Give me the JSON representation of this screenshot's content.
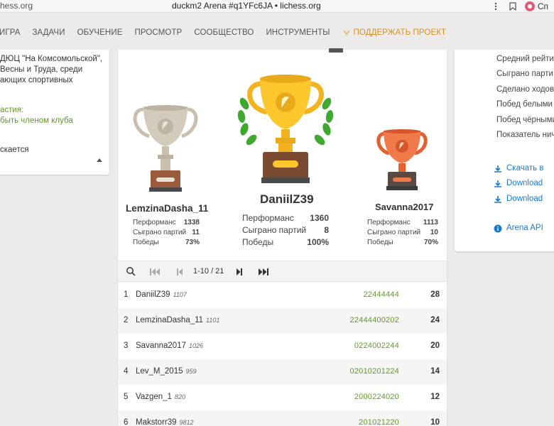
{
  "browser": {
    "url_left": "hess.org",
    "title": "duckm2 Arena #q1YFc6JA • lichess.org",
    "profile_label": "Сп"
  },
  "nav": {
    "items": [
      "ИГРА",
      "ЗАДАЧИ",
      "ОБУЧЕНИЕ",
      "ПРОСМОТР",
      "СООБЩЕСТВО",
      "ИНСТРУМЕНТЫ"
    ],
    "support": "ПОДДЕРЖАТЬ ПРОЕКТ"
  },
  "left_panel": {
    "description": "ДЮЦ \"На Комсомольской\", Весны и Труда, среди ающих спортивных",
    "condition_label": "астия:",
    "condition_link": "быть членом клуба",
    "starts": "скается"
  },
  "right_panel": {
    "stats": [
      "Средний рейти",
      "Сыграно парти",
      "Сделано ходов",
      "Побед белыми",
      "Побед чёрными",
      "Показатель нич"
    ],
    "downloads": [
      "Скачать в",
      "Download",
      "Download"
    ],
    "api": "Arena API"
  },
  "podium": {
    "first": {
      "name": "DaniilZ39",
      "performance_label": "Перформанс",
      "performance": "1360",
      "games_label": "Сыграно партий",
      "games": "8",
      "wins_label": "Победы",
      "wins": "100%"
    },
    "second": {
      "name": "LemzinaDasha_11",
      "performance_label": "Перформанс",
      "performance": "1338",
      "games_label": "Сыграно партий",
      "games": "11",
      "wins_label": "Победы",
      "wins": "73%"
    },
    "third": {
      "name": "Savanna2017",
      "performance_label": "Перформанс",
      "performance": "1113",
      "games_label": "Сыграно партий",
      "games": "10",
      "wins_label": "Победы",
      "wins": "70%"
    }
  },
  "pager": {
    "count": "1-10 / 21"
  },
  "standings": [
    {
      "rank": "1",
      "name": "DaniilZ39",
      "rating": "1107",
      "sheet": "22444444",
      "total": "28"
    },
    {
      "rank": "2",
      "name": "LemzinaDasha_11",
      "rating": "1101",
      "sheet": "22444400202",
      "total": "24"
    },
    {
      "rank": "3",
      "name": "Savanna2017",
      "rating": "1026",
      "sheet": "0224002244",
      "total": "20"
    },
    {
      "rank": "4",
      "name": "Lev_M_2015",
      "rating": "959",
      "sheet": "02010201224",
      "total": "14"
    },
    {
      "rank": "5",
      "name": "Vazgen_1",
      "rating": "820",
      "sheet": "2000224020",
      "total": "12"
    },
    {
      "rank": "6",
      "name": "Makstorr39",
      "rating": "9812",
      "sheet": "201021220",
      "total": "10"
    }
  ]
}
